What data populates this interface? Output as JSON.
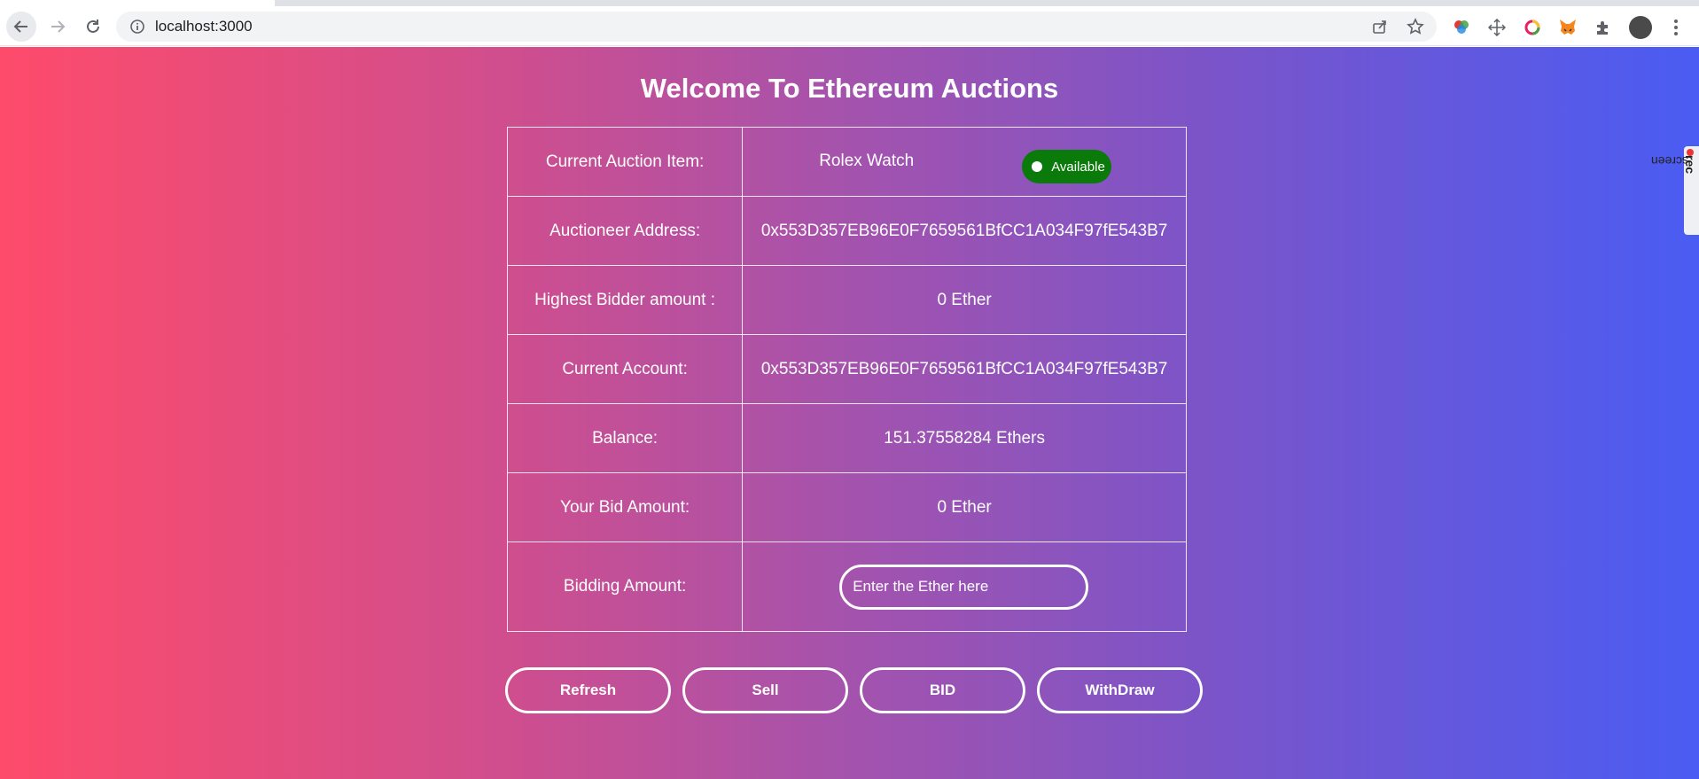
{
  "browser": {
    "url": "localhost:3000"
  },
  "page": {
    "title": "Welcome To Ethereum Auctions",
    "rows": [
      {
        "label": "Current Auction Item:",
        "value": "Rolex Watch"
      },
      {
        "label": "Auctioneer Address:",
        "value": "0x553D357EB96E0F7659561BfCC1A034F97fE543B7"
      },
      {
        "label": "Highest Bidder amount :",
        "value": "0 Ether"
      },
      {
        "label": "Current Account:",
        "value": "0x553D357EB96E0F7659561BfCC1A034F97fE543B7"
      },
      {
        "label": "Balance:",
        "value": "151.37558284 Ethers"
      },
      {
        "label": "Your Bid Amount:",
        "value": "0 Ether"
      },
      {
        "label": "Bidding Amount:",
        "placeholder": "Enter the Ether here"
      }
    ],
    "status_badge": "Available",
    "buttons": {
      "refresh": "Refresh",
      "sell": "Sell",
      "bid": "BID",
      "withdraw": "WithDraw"
    }
  },
  "screenrec": {
    "prefix": "screen",
    "suffix": "rec"
  },
  "colors": {
    "gradient_start": "#fe4b6b",
    "gradient_end": "#4a5cf3",
    "badge_green": "#0a7a0a"
  }
}
